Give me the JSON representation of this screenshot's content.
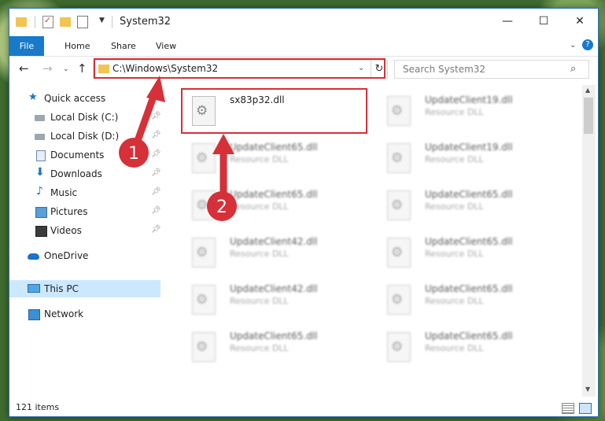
{
  "window": {
    "title": "System32",
    "controls": {
      "minimize": "—",
      "maximize": "☐",
      "close": "✕"
    }
  },
  "ribbon": {
    "tabs": [
      "File",
      "Home",
      "Share",
      "View"
    ]
  },
  "nav": {
    "address": "C:\\Windows\\System32",
    "search_placeholder": "Search System32"
  },
  "sidebar": {
    "items": [
      {
        "label": "Quick access",
        "icon": "star-icon"
      },
      {
        "label": "Local Disk (C:)",
        "icon": "drive-icon",
        "pinned": true
      },
      {
        "label": "Local Disk (D:)",
        "icon": "drive-icon",
        "pinned": true
      },
      {
        "label": "Documents",
        "icon": "documents-icon",
        "pinned": true
      },
      {
        "label": "Downloads",
        "icon": "download-icon",
        "pinned": true
      },
      {
        "label": "Music",
        "icon": "music-icon",
        "pinned": true
      },
      {
        "label": "Pictures",
        "icon": "pictures-icon",
        "pinned": true
      },
      {
        "label": "Videos",
        "icon": "videos-icon",
        "pinned": true
      },
      {
        "label": "OneDrive",
        "icon": "cloud-icon"
      },
      {
        "label": "This PC",
        "icon": "computer-icon",
        "selected": true
      },
      {
        "label": "Network",
        "icon": "network-icon"
      }
    ]
  },
  "files": [
    {
      "name": "sx83p32.dll",
      "type": ""
    },
    {
      "name": "UpdateClient19.dll",
      "type": "Resource DLL"
    },
    {
      "name": "UpdateClient65.dll",
      "type": "Resource DLL"
    },
    {
      "name": "UpdateClient19.dll",
      "type": "Resource DLL"
    },
    {
      "name": "UpdateClient65.dll",
      "type": "Resource DLL"
    },
    {
      "name": "UpdateClient65.dll",
      "type": "Resource DLL"
    },
    {
      "name": "UpdateClient42.dll",
      "type": "Resource DLL"
    },
    {
      "name": "UpdateClient65.dll",
      "type": "Resource DLL"
    },
    {
      "name": "UpdateClient42.dll",
      "type": "Resource DLL"
    },
    {
      "name": "UpdateClient65.dll",
      "type": "Resource DLL"
    },
    {
      "name": "UpdateClient65.dll",
      "type": "Resource DLL"
    },
    {
      "name": "UpdateClient65.dll",
      "type": "Resource DLL"
    }
  ],
  "status": {
    "items": "121 items"
  },
  "annotations": {
    "step1": "1",
    "step2": "2"
  },
  "colors": {
    "accent": "#1979ca",
    "callout": "#d63038",
    "selection": "#cce8ff"
  }
}
